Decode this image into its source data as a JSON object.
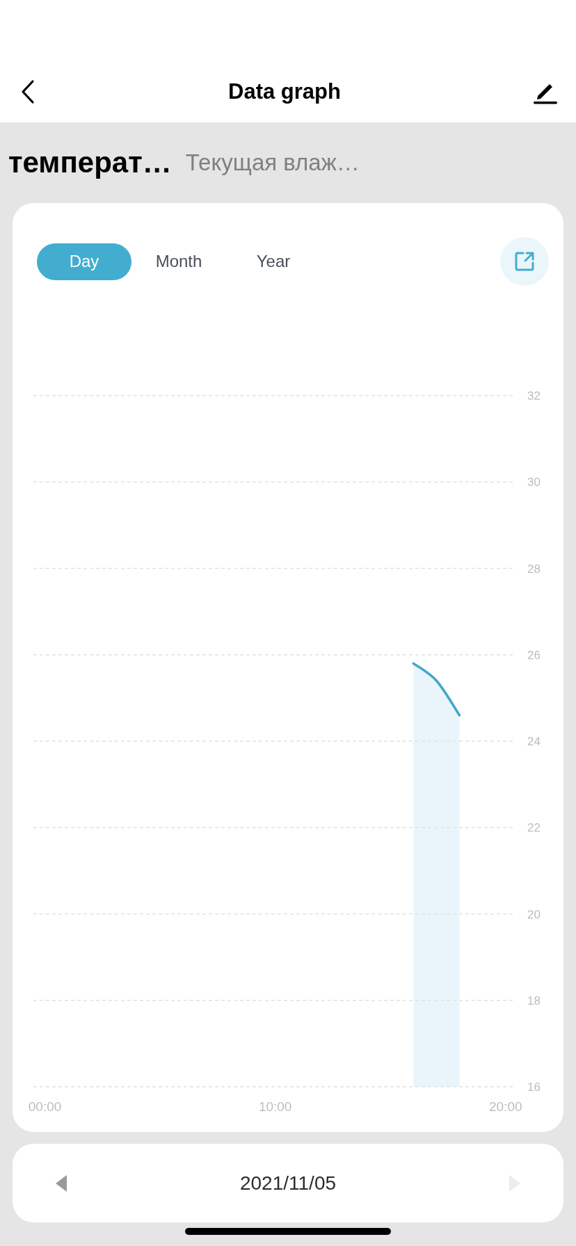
{
  "header": {
    "title": "Data graph"
  },
  "metrics": [
    {
      "label": "температ…",
      "selected": true
    },
    {
      "label": "Текущая влаж…",
      "selected": false
    }
  ],
  "periods": [
    {
      "label": "Day",
      "selected": true
    },
    {
      "label": "Month",
      "selected": false
    },
    {
      "label": "Year",
      "selected": false
    }
  ],
  "chart_data": {
    "type": "area",
    "x": [
      16,
      17,
      18
    ],
    "series": [
      {
        "color": "#3fa9c9",
        "values": [
          25.8,
          25.4,
          24.6
        ]
      }
    ],
    "xlim": [
      -0.5,
      20.4
    ],
    "ylim": [
      16,
      32
    ],
    "grid": true,
    "xticks": [
      {
        "value": 0,
        "label": "00:00"
      },
      {
        "value": 10,
        "label": "10:00"
      },
      {
        "value": 20,
        "label": "20:00"
      }
    ],
    "yticks": [
      16,
      18,
      20,
      22,
      24,
      26,
      28,
      30,
      32
    ]
  },
  "date_nav": {
    "date": "2021/11/05",
    "prev_disabled": false,
    "next_disabled": true
  }
}
